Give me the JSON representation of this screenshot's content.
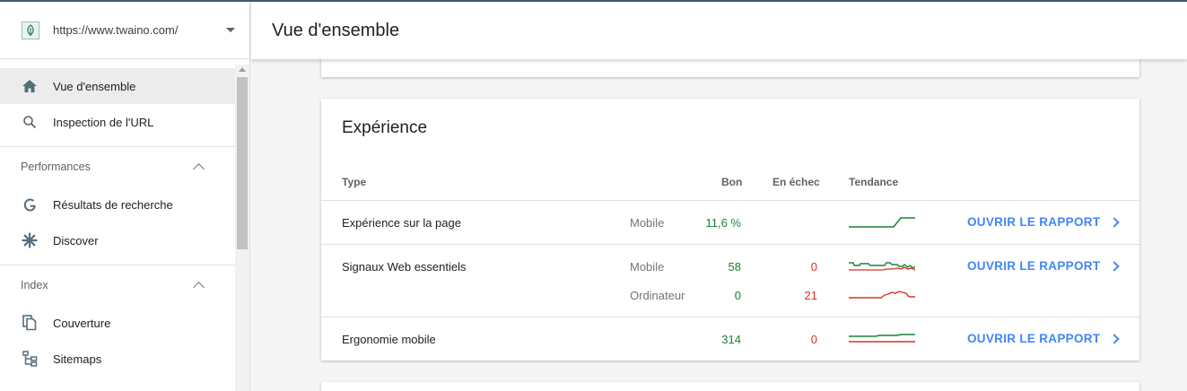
{
  "property": {
    "url": "https://www.twaino.com/"
  },
  "header": {
    "title": "Vue d'ensemble"
  },
  "sidebar": {
    "top_items": [
      {
        "label": "Vue d'ensemble",
        "icon": "home-icon"
      },
      {
        "label": "Inspection de l'URL",
        "icon": "search-icon"
      }
    ],
    "sections": [
      {
        "title": "Performances",
        "items": [
          {
            "label": "Résultats de recherche",
            "icon": "google-icon"
          },
          {
            "label": "Discover",
            "icon": "asterisk-icon"
          }
        ]
      },
      {
        "title": "Index",
        "items": [
          {
            "label": "Couverture",
            "icon": "pages-icon"
          },
          {
            "label": "Sitemaps",
            "icon": "sitemap-icon"
          }
        ]
      }
    ]
  },
  "experience": {
    "title": "Expérience",
    "headers": {
      "type": "Type",
      "good": "Bon",
      "bad": "En échec",
      "trend": "Tendance"
    },
    "link_label": "OUVRIR LE RAPPORT",
    "rows": [
      {
        "type": "Expérience sur la page",
        "device": "Mobile",
        "good": "11,6 %",
        "bad": ""
      },
      {
        "type": "Signaux Web essentiels",
        "device": "Mobile",
        "good": "58",
        "bad": "0"
      },
      {
        "type": "",
        "device": "Ordinateur",
        "good": "0",
        "bad": "21"
      },
      {
        "type": "Ergonomie mobile",
        "device": "",
        "good": "314",
        "bad": "0"
      }
    ]
  },
  "colors": {
    "good": "#188038",
    "bad": "#d93025",
    "link": "#4285f4"
  }
}
